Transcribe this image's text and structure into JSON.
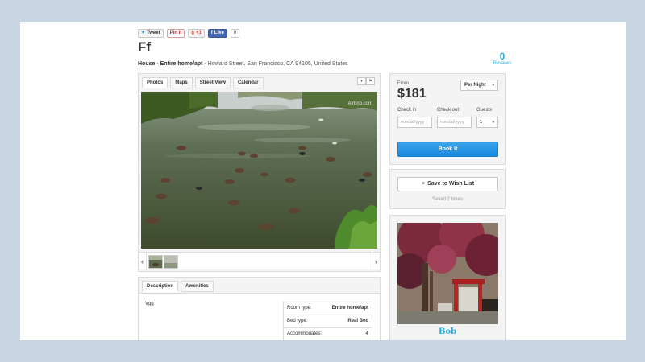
{
  "social": {
    "tweet": "Tweet",
    "pin": "Pin it",
    "gplus": "+1",
    "like": "Like",
    "like_count": "0"
  },
  "listing": {
    "title": "Ff",
    "type": "House - Entire home/apt",
    "address": " - Howard Street, San Francisco, CA 94105, United States"
  },
  "reviews": {
    "count": "0",
    "label": "Reviews"
  },
  "photo_tabs": [
    "Photos",
    "Maps",
    "Street View",
    "Calendar"
  ],
  "photo": {
    "watermark": "Airbnb.com"
  },
  "description_tabs": [
    "Description",
    "Amenities"
  ],
  "description": {
    "text": "Vgg"
  },
  "properties": [
    {
      "label": "Room type:",
      "value": "Entire home/apt"
    },
    {
      "label": "Bed type:",
      "value": "Real Bed"
    },
    {
      "label": "Accommodates:",
      "value": "4"
    }
  ],
  "booking": {
    "from_label": "From",
    "price": "$181",
    "period": "Per Night",
    "checkin_label": "Check in",
    "checkout_label": "Check out",
    "guests_label": "Guests",
    "date_placeholder": "mm/dd/yyyy",
    "guests_value": "1",
    "book_label": "Book It"
  },
  "wishlist": {
    "button": "Save to Wish List",
    "saved": "Saved 2 times"
  },
  "host": {
    "name": "Bob"
  },
  "colors": {
    "accent": "#2aa9d9",
    "book_button": "#1a8be0",
    "background": "#c9d6e2"
  }
}
